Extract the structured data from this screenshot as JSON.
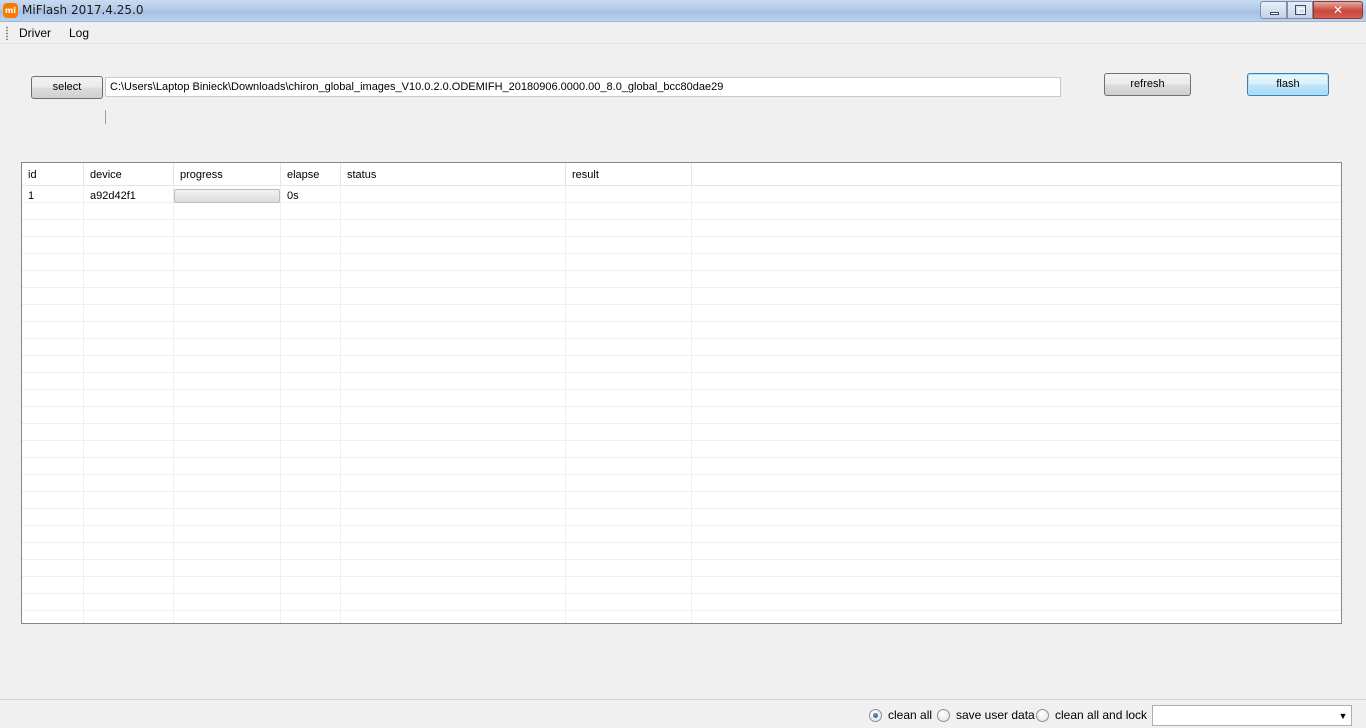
{
  "window": {
    "title": "MiFlash 2017.4.25.0",
    "icon_text": "mi"
  },
  "menu": {
    "items": [
      "Driver",
      "Log"
    ]
  },
  "toolbar": {
    "select_label": "select",
    "path_value": "C:\\Users\\Laptop Binieck\\Downloads\\chiron_global_images_V10.0.2.0.ODEMIFH_20180906.0000.00_8.0_global_bcc80dae29",
    "refresh_label": "refresh",
    "flash_label": "flash"
  },
  "grid": {
    "columns": [
      "id",
      "device",
      "progress",
      "elapse",
      "status",
      "result"
    ],
    "rows": [
      {
        "id": "1",
        "device": "a92d42f1",
        "progress": 0,
        "elapse": "0s",
        "status": "",
        "result": ""
      }
    ]
  },
  "footer": {
    "options": [
      "clean all",
      "save user data",
      "clean all and lock"
    ],
    "selected": "clean all",
    "combo_value": ""
  },
  "colors": {
    "progress_fill": "#37c333",
    "flash_border": "#3c7fb1",
    "titlebar": "#b4cbe8"
  }
}
